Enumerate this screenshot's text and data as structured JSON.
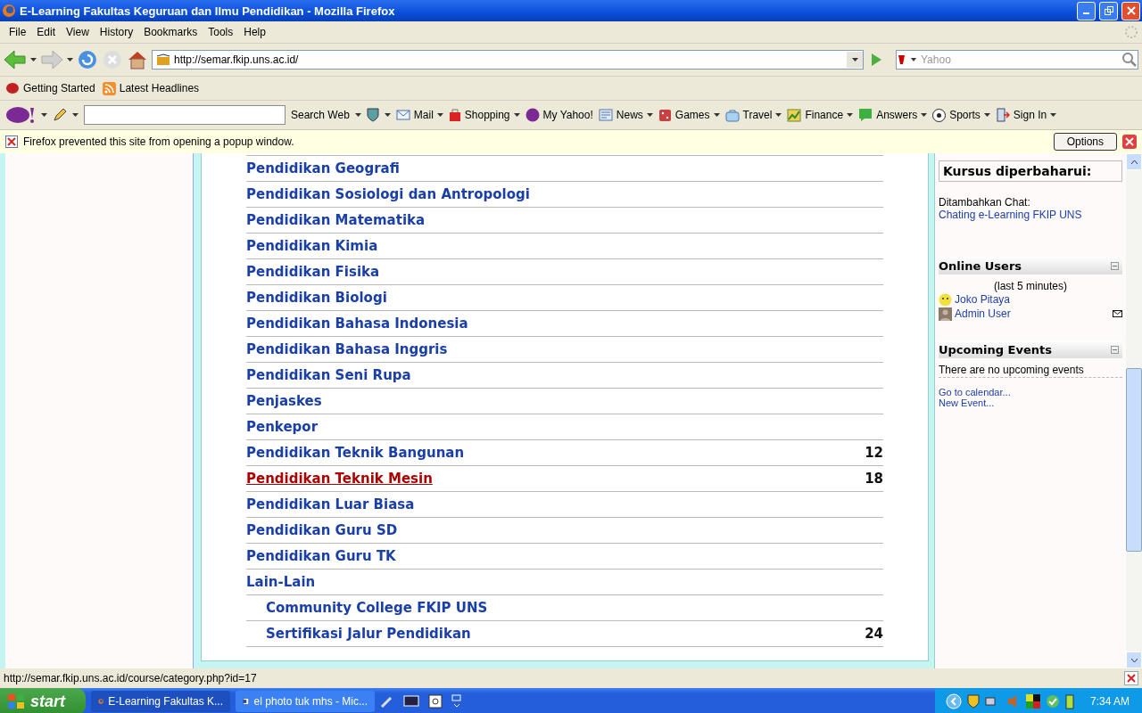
{
  "window": {
    "title": "E-Learning Fakultas Keguruan dan Ilmu Pendidikan - Mozilla Firefox"
  },
  "menu": [
    "File",
    "Edit",
    "View",
    "History",
    "Bookmarks",
    "Tools",
    "Help"
  ],
  "address_bar": {
    "value": "http://semar.fkip.uns.ac.id/"
  },
  "search_bar": {
    "placeholder": "Yahoo"
  },
  "bookmarks": [
    {
      "kind": "start",
      "label": "Getting Started"
    },
    {
      "kind": "feed",
      "label": "Latest Headlines"
    }
  ],
  "yahoo_toolbar": {
    "search_label": "Search Web",
    "items": [
      {
        "kind": "mail",
        "label": "Mail"
      },
      {
        "kind": "shopping",
        "label": "Shopping"
      },
      {
        "kind": "my",
        "label": "My Yahoo!"
      },
      {
        "kind": "news",
        "label": "News"
      },
      {
        "kind": "games",
        "label": "Games"
      },
      {
        "kind": "travel",
        "label": "Travel"
      },
      {
        "kind": "finance",
        "label": "Finance"
      },
      {
        "kind": "answers",
        "label": "Answers"
      },
      {
        "kind": "sports",
        "label": "Sports"
      },
      {
        "kind": "signin",
        "label": "Sign In"
      }
    ]
  },
  "notification": {
    "text": "Firefox prevented this site from opening a popup window.",
    "button": "Options"
  },
  "categories": [
    {
      "name": "Pendidikan Geografi",
      "hovered": false
    },
    {
      "name": "Pendidikan Sosiologi dan Antropologi",
      "hovered": false
    },
    {
      "name": "Pendidikan Matematika",
      "hovered": false
    },
    {
      "name": "Pendidikan Kimia",
      "hovered": false
    },
    {
      "name": "Pendidikan Fisika",
      "hovered": false
    },
    {
      "name": "Pendidikan Biologi",
      "hovered": false
    },
    {
      "name": "Pendidikan Bahasa Indonesia",
      "hovered": false
    },
    {
      "name": "Pendidikan Bahasa Inggris",
      "hovered": false
    },
    {
      "name": "Pendidikan Seni Rupa",
      "hovered": false
    },
    {
      "name": "Penjaskes",
      "hovered": false
    },
    {
      "name": "Penkepor",
      "hovered": false
    },
    {
      "name": "Pendidikan Teknik Bangunan",
      "count": "12",
      "hovered": false
    },
    {
      "name": "Pendidikan Teknik Mesin",
      "count": "18",
      "hovered": true
    },
    {
      "name": "Pendidikan Luar Biasa",
      "hovered": false
    },
    {
      "name": "Pendidikan Guru SD",
      "hovered": false
    },
    {
      "name": "Pendidikan Guru TK",
      "hovered": false
    },
    {
      "name": "Lain-Lain",
      "hovered": false,
      "children": [
        {
          "name": "Community College FKIP UNS",
          "hovered": false
        },
        {
          "name": "Sertifikasi Jalur Pendidikan",
          "count": "24",
          "hovered": false
        }
      ]
    }
  ],
  "sidebar": {
    "recent": {
      "title": "Kursus diperbaharui:",
      "label": "Ditambahkan Chat:",
      "link": "Chating e-Learning FKIP UNS"
    },
    "online_users": {
      "title": "Online Users",
      "note": "(last 5 minutes)",
      "users": [
        {
          "name": "Joko Pitaya",
          "kind": "smiley",
          "message": false
        },
        {
          "name": "Admin User",
          "kind": "photo",
          "message": true
        }
      ]
    },
    "upcoming_events": {
      "title": "Upcoming Events",
      "text": "There are no upcoming events",
      "links": [
        "Go to calendar...",
        "New Event..."
      ]
    }
  },
  "status_bar": {
    "text": "http://semar.fkip.uns.ac.id/course/category.php?id=17"
  },
  "taskbar": {
    "start": "start",
    "tasks": [
      {
        "kind": "firefox",
        "label": "E-Learning Fakultas K...",
        "selected": true
      },
      {
        "kind": "word",
        "label": "el photo tuk mhs - Mic...",
        "selected": false
      }
    ],
    "clock": "7:34 AM"
  }
}
